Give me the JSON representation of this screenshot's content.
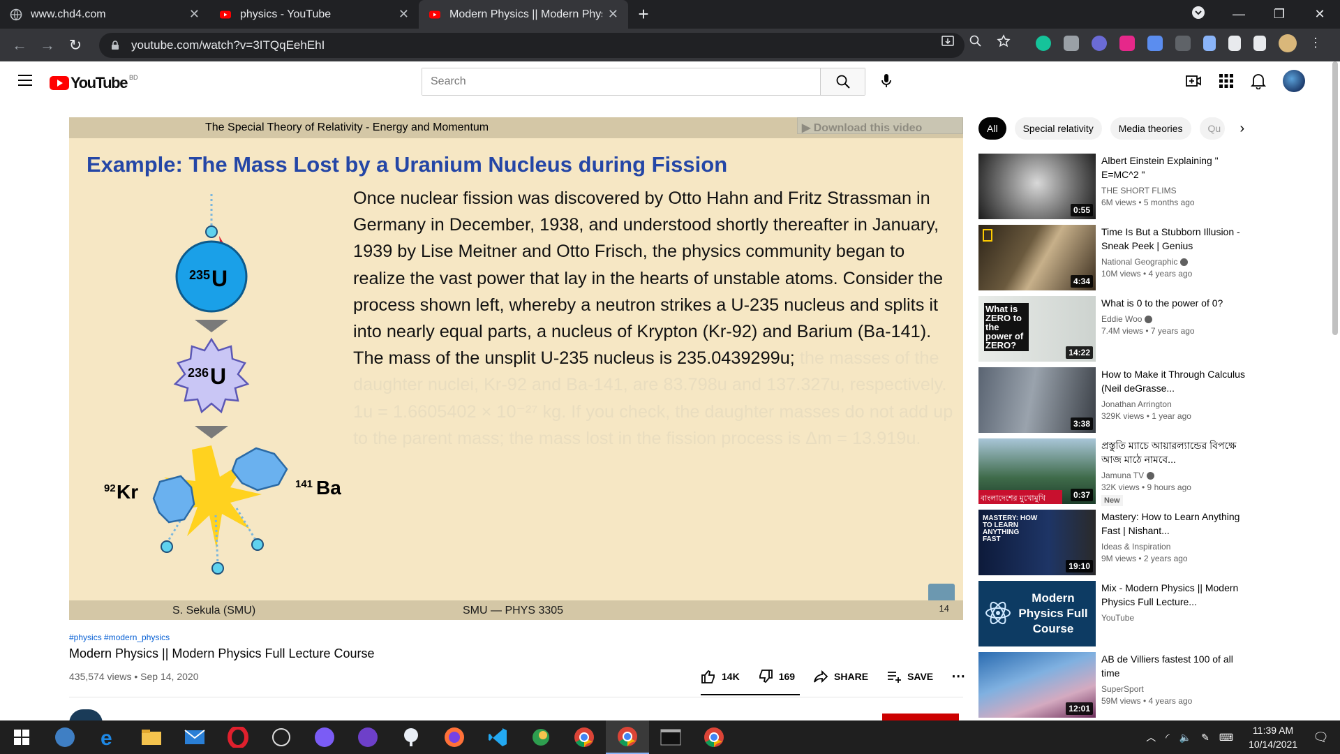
{
  "browser": {
    "tabs": [
      {
        "title": "www.chd4.com",
        "icon": "globe-icon"
      },
      {
        "title": "physics - YouTube",
        "icon": "youtube-icon"
      },
      {
        "title": "Modern Physics || Modern Physic",
        "icon": "youtube-icon"
      }
    ],
    "url": "youtube.com/watch?v=3ITQqEehEhI"
  },
  "youtube": {
    "logo_text": "YouTube",
    "country": "BD",
    "search_placeholder": "Search"
  },
  "player": {
    "header": "The Special Theory of Relativity - Energy and Momentum",
    "download_label": "Download this video",
    "slide_title": "Example: The Mass Lost by a Uranium Nucleus during Fission",
    "body_visible": "Once nuclear fission was discovered by Otto Hahn and Fritz Strassman in Germany in December, 1938, and understood shortly thereafter in January, 1939 by Lise Meitner and Otto Frisch, the physics community began to realize the vast power that lay in the hearts of unstable atoms. Consider the process shown left, whereby a neutron strikes a U-235 nucleus and splits it into nearly equal parts, a nucleus of Krypton (Kr-92) and Barium (Ba-141). The mass of the unsplit U-235 nucleus is 235.0439299u;",
    "body_faded": " the masses of the daughter nuclei, Kr-92 and Ba-141, are 83.798u and 137.327u, respectively. 1u = 1.6605402 × 10⁻²⁷ kg. If you check, the daughter masses do not add up to the parent mass; the mass lost in the fission process is Δm = 13.919u.",
    "labels": {
      "u235_mass": "235",
      "u236_mass": "236",
      "u": "U",
      "kr_mass": "92",
      "kr": "Kr",
      "ba_mass": "141",
      "ba": "Ba"
    },
    "footer_left": "S. Sekula  (SMU)",
    "footer_right": "SMU — PHYS 3305",
    "page_number": "14"
  },
  "video": {
    "tags": "#physics #modern_physics",
    "title": "Modern Physics || Modern Physics Full Lecture Course",
    "meta": "435,574 views • Sep 14, 2020",
    "likes": "14K",
    "dislikes": "169",
    "share_label": "SHARE",
    "save_label": "SAVE"
  },
  "chips": [
    "All",
    "Special relativity",
    "Media theories",
    "Qu"
  ],
  "recommendations": [
    {
      "title": "Albert Einstein Explaining \" E=MC^2 \"",
      "channel": "THE SHORT FLIMS",
      "verified": false,
      "meta": "6M views • 5 months ago",
      "duration": "0:55",
      "badge": "",
      "thumb_text": ""
    },
    {
      "title": "Time Is But a Stubborn Illusion - Sneak Peek | Genius",
      "channel": "National Geographic",
      "verified": true,
      "meta": "10M views • 4 years ago",
      "duration": "4:34",
      "badge": "",
      "thumb_text": ""
    },
    {
      "title": "What is 0 to the power of 0?",
      "channel": "Eddie Woo",
      "verified": true,
      "meta": "7.4M views • 7 years ago",
      "duration": "14:22",
      "badge": "",
      "thumb_text": "What is ZERO to the power of ZERO?"
    },
    {
      "title": "How to Make it Through Calculus (Neil deGrasse...",
      "channel": "Jonathan Arrington",
      "verified": false,
      "meta": "329K views • 1 year ago",
      "duration": "3:38",
      "badge": "",
      "thumb_text": ""
    },
    {
      "title": "প্রস্তুতি ম্যাচে আয়ারল্যান্ডের বিপক্ষে আজ মাঠে নামবে...",
      "channel": "Jamuna TV",
      "verified": true,
      "meta": "32K views • 9 hours ago",
      "duration": "0:37",
      "badge": "New",
      "thumb_text": "বাংলাদেশের মুখোমুখি আয়ার"
    },
    {
      "title": "Mastery: How to Learn Anything Fast | Nishant...",
      "channel": "Ideas & Inspiration",
      "verified": false,
      "meta": "9M views • 2 years ago",
      "duration": "19:10",
      "badge": "",
      "thumb_text": "MASTERY: HOW TO LEARN ANYTHING FAST"
    },
    {
      "title": "Mix - Modern Physics || Modern Physics Full Lecture...",
      "channel": "YouTube",
      "verified": false,
      "meta": "",
      "duration": "",
      "badge": "",
      "thumb_text": "Modern Physics Full Course"
    },
    {
      "title": "AB de Villiers fastest 100 of all time",
      "channel": "SuperSport",
      "verified": false,
      "meta": "59M views • 4 years ago",
      "duration": "12:01",
      "badge": "",
      "thumb_text": ""
    }
  ],
  "taskbar": {
    "time": "11:39 AM",
    "date": "10/14/2021"
  },
  "colors": {
    "chrome_dark": "#202124",
    "yt_red": "#ff0000",
    "slide_bg": "#f6e7c4",
    "slide_title": "#2446a6",
    "nucleus_blue": "#1aa0e8",
    "star_yellow": "#ffd21f"
  }
}
